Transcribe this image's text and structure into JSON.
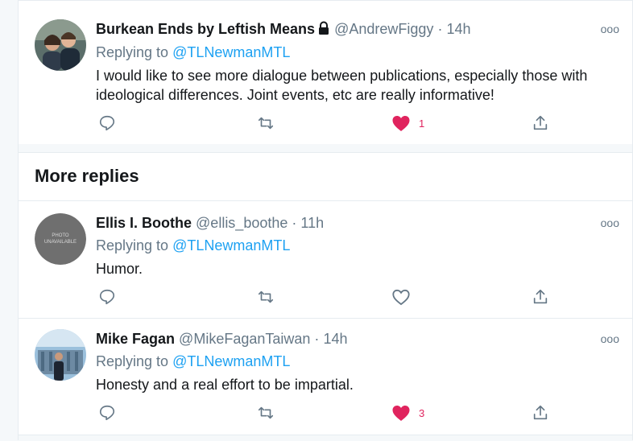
{
  "tweets": [
    {
      "name": "Burkean Ends by Leftish Means",
      "handle": "@AndrewFiggy",
      "separator": "·",
      "time": "14h",
      "replying_prefix": "Replying to ",
      "replying_to": "@TLNewmanMTL",
      "text": "I would like to see more dialogue between publications, especially those with ideological differences. Joint events, etc are really informative!",
      "like_count": "1",
      "liked": true,
      "more": "ooo"
    },
    {
      "name": "Ellis I. Boothe",
      "handle": "@ellis_boothe",
      "separator": "·",
      "time": "11h",
      "replying_prefix": "Replying to ",
      "replying_to": "@TLNewmanMTL",
      "text": "Humor.",
      "like_count": "",
      "liked": false,
      "more": "ooo",
      "avatar_placeholder": "PHOTO UNAVAILABLE"
    },
    {
      "name": "Mike Fagan",
      "handle": "@MikeFaganTaiwan",
      "separator": "·",
      "time": "14h",
      "replying_prefix": "Replying to ",
      "replying_to": "@TLNewmanMTL",
      "text": "Honesty and a real effort to be impartial.",
      "like_count": "3",
      "liked": true,
      "more": "ooo"
    }
  ],
  "section": {
    "more_replies": "More replies"
  },
  "icons": {
    "reply": "reply-icon",
    "retweet": "retweet-icon",
    "like": "heart-icon",
    "share": "share-icon",
    "lock": "lock-icon"
  },
  "colors": {
    "accent": "#1da1f2",
    "like": "#e0245e",
    "muted": "#657786",
    "text": "#14171a"
  }
}
